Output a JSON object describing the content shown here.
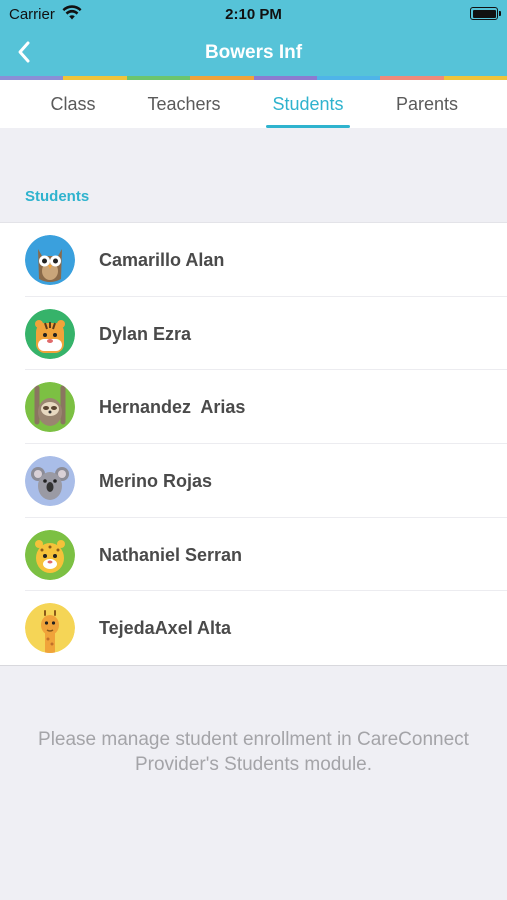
{
  "status_bar": {
    "carrier": "Carrier",
    "time": "2:10 PM"
  },
  "nav": {
    "title": "Bowers Inf",
    "back_icon": "chevron-left-icon"
  },
  "rainbow_colors": [
    "#8a8fd6",
    "#f0c43a",
    "#6bc56e",
    "#f0a33a",
    "#8b7bd0",
    "#4fb4e8",
    "#f08a7a",
    "#f0c43a"
  ],
  "tabs": [
    {
      "label": "Class",
      "active": false
    },
    {
      "label": "Teachers",
      "active": false
    },
    {
      "label": "Students",
      "active": true
    },
    {
      "label": "Parents",
      "active": false
    }
  ],
  "section": {
    "header": "Students"
  },
  "students": [
    {
      "name": "Camarillo Alan",
      "avatar": "owl-avatar",
      "bg": "#3aa0dd"
    },
    {
      "name": "Dylan Ezra",
      "avatar": "tiger-avatar",
      "bg": "#36b36a"
    },
    {
      "name": "Hernandez  Arias",
      "avatar": "sloth-avatar",
      "bg": "#7cc043"
    },
    {
      "name": "Merino Rojas",
      "avatar": "koala-avatar",
      "bg": "#a9bde8"
    },
    {
      "name": "Nathaniel Serran",
      "avatar": "leopard-avatar",
      "bg": "#7cc043"
    },
    {
      "name": "TejedaAxel Alta",
      "avatar": "giraffe-avatar",
      "bg": "#f5d556"
    }
  ],
  "footer": {
    "note": "Please manage student enrollment in CareConnect Provider's Students module."
  }
}
